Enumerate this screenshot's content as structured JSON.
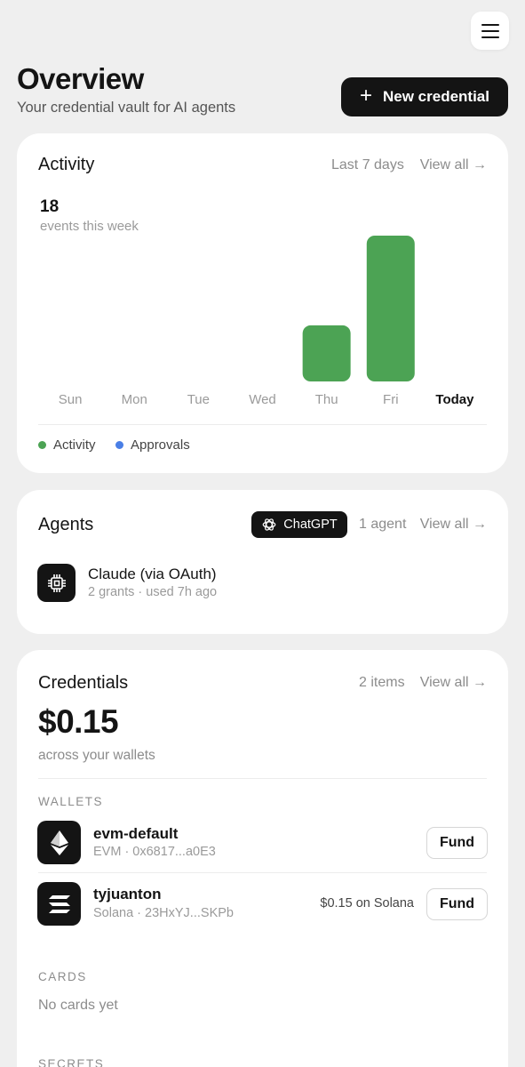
{
  "header": {
    "title": "Overview",
    "subtitle": "Your credential vault for AI agents",
    "new_button_label": "New credential",
    "menu_icon": "hamburger-menu-icon"
  },
  "activity": {
    "title": "Activity",
    "range_label": "Last 7 days",
    "view_all": "View all →",
    "events_count": "18",
    "events_label": "events this week",
    "legend": [
      {
        "label": "Activity",
        "color": "#4ca354"
      },
      {
        "label": "Approvals",
        "color": "#4a7fe6"
      }
    ]
  },
  "chart_data": {
    "type": "bar",
    "categories": [
      "Sun",
      "Mon",
      "Tue",
      "Wed",
      "Thu",
      "Fri",
      "Today"
    ],
    "series": [
      {
        "name": "Activity",
        "color": "#4ca354",
        "values": [
          0,
          0,
          0,
          0,
          5,
          13,
          0
        ]
      },
      {
        "name": "Approvals",
        "color": "#4a7fe6",
        "values": [
          0,
          0,
          0,
          0,
          0,
          0,
          0
        ]
      }
    ],
    "ylim": [
      0,
      13
    ],
    "highlight_category": "Today",
    "grid": false,
    "legend_position": "bottom-left"
  },
  "agents": {
    "title": "Agents",
    "badge_label": "ChatGPT",
    "badge_icon": "openai-logo-icon",
    "count_label": "1 agent",
    "view_all": "View all →",
    "items": [
      {
        "name": "Claude (via OAuth)",
        "sub": "2 grants · used 7h ago",
        "icon": "chip-icon"
      }
    ]
  },
  "credentials": {
    "title": "Credentials",
    "count_label": "2 items",
    "view_all": "View all →",
    "balance": "$0.15",
    "balance_sub": "across your wallets",
    "wallets_label": "WALLETS",
    "wallets": [
      {
        "name": "evm-default",
        "sub": "EVM · 0x6817...a0E3",
        "balance": "",
        "fund_label": "Fund",
        "icon": "ethereum-icon"
      },
      {
        "name": "tyjuanton",
        "sub": "Solana · 23HxYJ...SKPb",
        "balance": "$0.15 on Solana",
        "fund_label": "Fund",
        "icon": "solana-icon"
      }
    ],
    "cards_label": "CARDS",
    "no_cards": "No cards yet",
    "secrets_label": "SECRETS"
  }
}
